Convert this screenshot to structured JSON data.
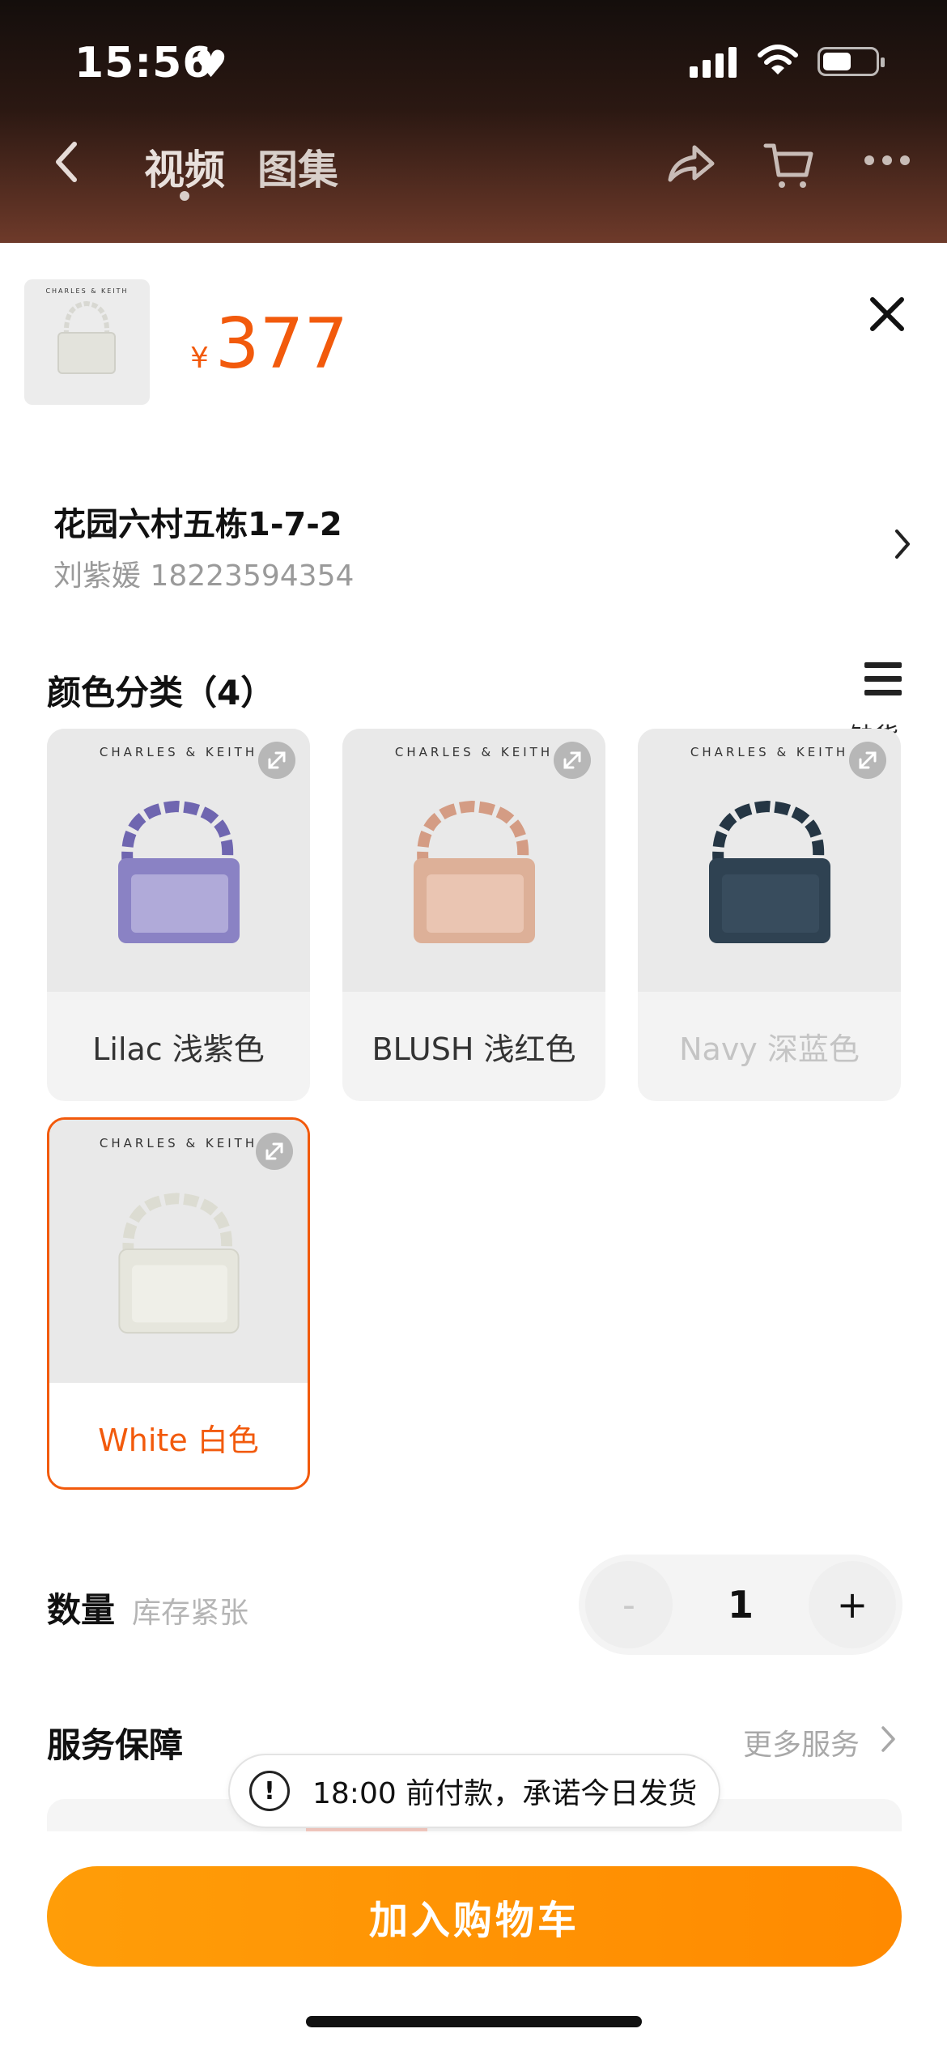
{
  "status_bar": {
    "time": "15:56",
    "icons": [
      "heart-icon",
      "signal-icon",
      "wifi-icon",
      "battery-icon"
    ]
  },
  "nav": {
    "tabs": [
      {
        "label": "视频"
      },
      {
        "label": "图集"
      }
    ],
    "icons": [
      "back-icon",
      "share-icon",
      "cart-icon",
      "more-icon"
    ]
  },
  "product": {
    "price_currency": "¥",
    "price": "377",
    "thumb_brand": "CHARLES & KEITH"
  },
  "address": {
    "title": "花园六村五栋1-7-2",
    "contact": "刘紫媛 18223594354"
  },
  "color_section": {
    "title": "颜色分类（4）",
    "out_of_stock_label": "缺货",
    "options": [
      {
        "label": "Lilac 浅紫色",
        "brand": "CHARLES & KEITH",
        "state": "available",
        "bag_color": "#7b72b8"
      },
      {
        "label": "BLUSH 浅红色",
        "brand": "CHARLES & KEITH",
        "state": "available",
        "bag_color": "#d9a48a"
      },
      {
        "label": "Navy 深蓝色",
        "brand": "CHARLES & KEITH",
        "state": "out_of_stock",
        "bag_color": "#2d3f4e"
      },
      {
        "label": "White 白色",
        "brand": "CHARLES & KEITH",
        "state": "selected",
        "bag_color": "#e8e8e0"
      }
    ]
  },
  "quantity": {
    "label": "数量",
    "note": "库存紧张",
    "minus": "-",
    "value": "1",
    "plus": "+"
  },
  "service": {
    "label": "服务保障",
    "more": "更多服务"
  },
  "toast": {
    "icon": "!",
    "text": "18:00 前付款，承诺今日发货"
  },
  "cta": {
    "label": "加入购物车"
  },
  "colors": {
    "accent": "#f25a0c",
    "cta": "#ff8f00"
  }
}
